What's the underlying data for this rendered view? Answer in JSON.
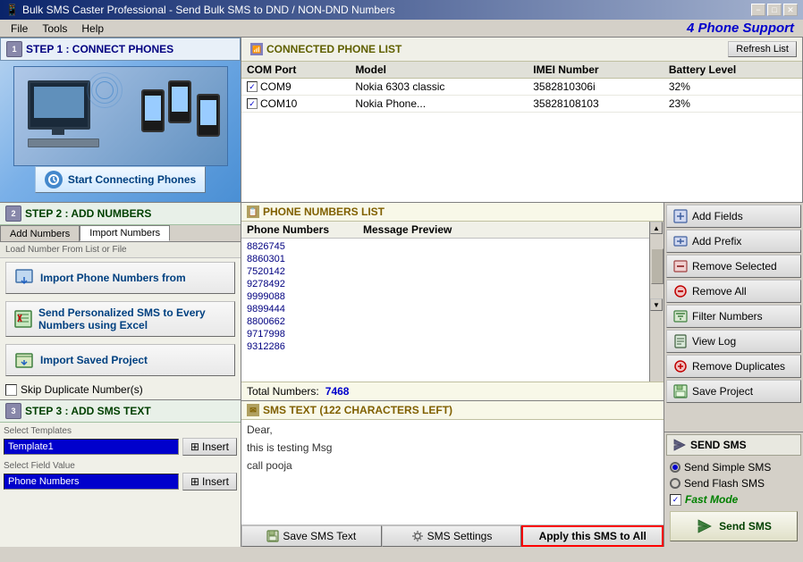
{
  "titlebar": {
    "title": "Bulk SMS Caster Professional - Send Bulk SMS to DND / NON-DND Numbers",
    "minimize": "−",
    "maximize": "□",
    "close": "✕"
  },
  "menubar": {
    "items": [
      "File",
      "Tools",
      "Help"
    ]
  },
  "brand": {
    "text": "4 Phone Support"
  },
  "step1": {
    "header": "STEP 1 : CONNECT PHONES",
    "start_btn": "Start Connecting Phones"
  },
  "connected": {
    "header": "CONNECTED PHONE LIST",
    "refresh_btn": "Refresh List",
    "columns": [
      "COM  Port",
      "Model",
      "IMEI Number",
      "Battery Level"
    ],
    "rows": [
      {
        "port": "COM9",
        "model": "Nokia 6303 classic",
        "imei": "3582810306i",
        "battery": "32%",
        "checked": true
      },
      {
        "port": "COM10",
        "model": "Nokia Phone...",
        "imei": "35828108103",
        "battery": "23%",
        "checked": true
      }
    ]
  },
  "step2": {
    "header": "STEP 2 : ADD NUMBERS",
    "tabs": [
      "Add Numbers",
      "Import Numbers"
    ],
    "section_label": "Load Number From List or File",
    "import_btn": "Import Phone Numbers from",
    "personalized_btn": "Send Personalized SMS to\nEvery Numbers using Excel",
    "project_btn": "Import Saved Project",
    "skip_label": "Skip Duplicate Number(s)"
  },
  "numbers_list": {
    "header": "PHONE NUMBERS LIST",
    "columns": [
      "Phone Numbers",
      "Message Preview"
    ],
    "numbers": [
      "8826745",
      "8860301",
      "7520142",
      "9278492",
      "9999088",
      "9899444",
      "8800662",
      "9717998",
      "9312286"
    ],
    "total_label": "Total Numbers:",
    "total_value": "7468"
  },
  "right_actions": {
    "add_fields": "Add Fields",
    "add_prefix": "Add Prefix",
    "remove_selected": "Remove Selected",
    "remove_all": "Remove All",
    "filter_numbers": "Filter Numbers",
    "view_log": "View Log",
    "remove_duplicates": "Remove Duplicates",
    "save_project": "Save Project"
  },
  "step3": {
    "header": "STEP 3 : ADD SMS TEXT",
    "select_templates_label": "Select Templates",
    "template_value": "Template1",
    "insert_label": "Insert",
    "select_field_label": "Select Field Value",
    "field_value": "Phone Numbers"
  },
  "sms": {
    "header": "SMS TEXT (122 CHARACTERS LEFT)",
    "text_lines": [
      "Dear,",
      "",
      "this is testing Msg",
      "",
      "call pooja"
    ],
    "save_btn": "Save SMS Text",
    "settings_btn": "SMS Settings",
    "apply_btn": "Apply this SMS to All"
  },
  "send_sms": {
    "header": "SEND SMS",
    "simple_label": "Send Simple SMS",
    "flash_label": "Send Flash SMS",
    "fast_mode_label": "Fast Mode",
    "send_btn": "Send SMS",
    "simple_checked": true,
    "flash_checked": false,
    "fast_mode_checked": true
  }
}
